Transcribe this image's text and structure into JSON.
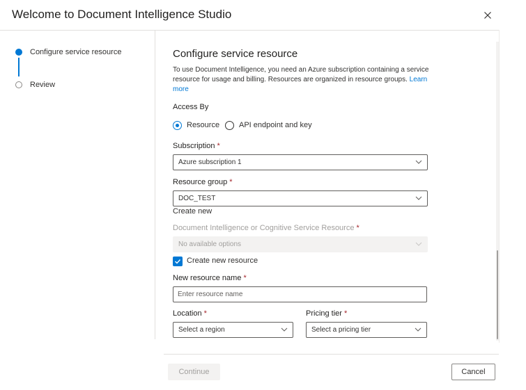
{
  "dialog": {
    "title": "Welcome to Document Intelligence Studio",
    "close_icon": "close-icon"
  },
  "steps": [
    {
      "label": "Configure service resource",
      "state": "active"
    },
    {
      "label": "Review",
      "state": "pending"
    }
  ],
  "main": {
    "heading": "Configure service resource",
    "description": "To use Document Intelligence, you need an Azure subscription containing a service resource for usage and billing. Resources are organized in resource groups.",
    "learn_more": "Learn more",
    "access_by": {
      "label": "Access By",
      "options": [
        {
          "label": "Resource",
          "selected": true
        },
        {
          "label": "API endpoint and key",
          "selected": false
        }
      ]
    },
    "subscription": {
      "label": "Subscription",
      "required": "*",
      "value": "Azure subscription 1"
    },
    "resource_group": {
      "label": "Resource group",
      "required": "*",
      "value": "DOC_TEST",
      "create_new": "Create new"
    },
    "service_resource": {
      "label": "Document Intelligence or Cognitive Service Resource",
      "required": "*",
      "value": "No available options",
      "disabled": true
    },
    "create_new_resource": {
      "label": "Create new resource",
      "checked": true
    },
    "new_resource_name": {
      "label": "New resource name",
      "required": "*",
      "placeholder": "Enter resource name"
    },
    "location": {
      "label": "Location",
      "required": "*",
      "value": "Select a region"
    },
    "pricing_tier": {
      "label": "Pricing tier",
      "required": "*",
      "value": "Select a pricing tier"
    }
  },
  "footer": {
    "continue": "Continue",
    "cancel": "Cancel"
  },
  "colors": {
    "accent": "#0078d4",
    "required": "#a4262c",
    "disabled_text": "#a19f9d"
  }
}
